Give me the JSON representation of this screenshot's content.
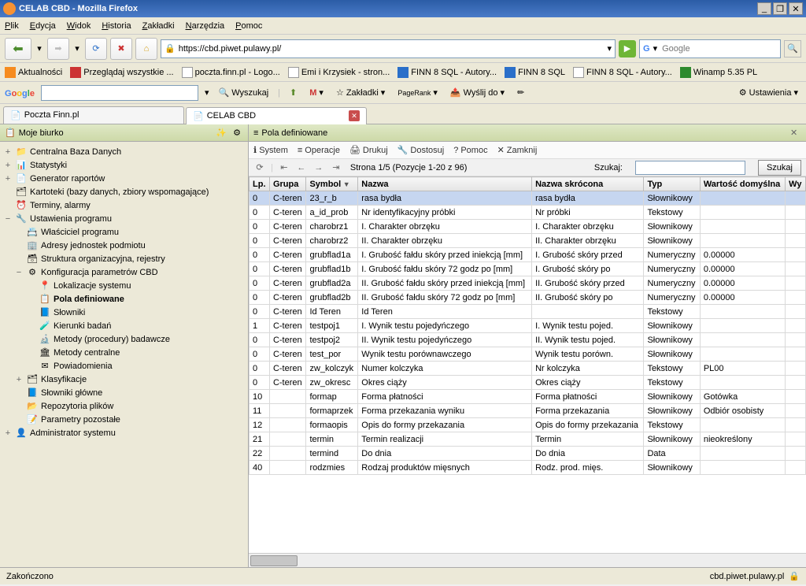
{
  "window": {
    "title": "CELAB CBD - Mozilla Firefox"
  },
  "menu": [
    "Plik",
    "Edycja",
    "Widok",
    "Historia",
    "Zakładki",
    "Narzędzia",
    "Pomoc"
  ],
  "url": "https://cbd.piwet.pulawy.pl/",
  "search_placeholder": "Google",
  "bookmarks": [
    {
      "label": "Aktualności",
      "icon": "rss"
    },
    {
      "label": "Przeglądaj wszystkie ...",
      "icon": "red"
    },
    {
      "label": "poczta.finn.pl - Logo...",
      "icon": "page"
    },
    {
      "label": "Emi i Krzysiek - stron...",
      "icon": "page"
    },
    {
      "label": "FINN 8 SQL - Autory...",
      "icon": "blue"
    },
    {
      "label": "FINN 8 SQL",
      "icon": "blue"
    },
    {
      "label": "FINN 8 SQL - Autory...",
      "icon": "page"
    },
    {
      "label": "Winamp 5.35 PL",
      "icon": "green"
    }
  ],
  "google": {
    "search_label": "Wyszukaj",
    "bookmarks_label": "Zakładki",
    "pagerank_label": "PageRank",
    "send_label": "Wyślij do",
    "settings_label": "Ustawienia"
  },
  "tabs": [
    {
      "label": "Poczta Finn.pl",
      "active": false,
      "closable": false
    },
    {
      "label": "CELAB CBD",
      "active": true,
      "closable": true
    }
  ],
  "sidebar": {
    "title": "Moje biurko",
    "tree": [
      {
        "exp": "+",
        "ind": 0,
        "icon": "📁",
        "label": "Centralna Baza Danych"
      },
      {
        "exp": "+",
        "ind": 0,
        "icon": "📊",
        "label": "Statystyki"
      },
      {
        "exp": "+",
        "ind": 0,
        "icon": "📄",
        "label": "Generator raportów"
      },
      {
        "exp": "",
        "ind": 0,
        "icon": "🗂",
        "label": "Kartoteki (bazy danych, zbiory wspomagające)"
      },
      {
        "exp": "",
        "ind": 0,
        "icon": "⏰",
        "label": "Terminy, alarmy"
      },
      {
        "exp": "−",
        "ind": 0,
        "icon": "🔧",
        "label": "Ustawienia programu"
      },
      {
        "exp": "",
        "ind": 1,
        "icon": "📇",
        "label": "Właściciel programu"
      },
      {
        "exp": "",
        "ind": 1,
        "icon": "🏢",
        "label": "Adresy jednostek podmiotu"
      },
      {
        "exp": "",
        "ind": 1,
        "icon": "🗃",
        "label": "Struktura organizacyjna, rejestry"
      },
      {
        "exp": "−",
        "ind": 1,
        "icon": "⚙",
        "label": "Konfiguracja parametrów CBD"
      },
      {
        "exp": "",
        "ind": 2,
        "icon": "📍",
        "label": "Lokalizacje systemu"
      },
      {
        "exp": "",
        "ind": 2,
        "icon": "📋",
        "label": "Pola definiowane",
        "bold": true
      },
      {
        "exp": "",
        "ind": 2,
        "icon": "📘",
        "label": "Słowniki"
      },
      {
        "exp": "",
        "ind": 2,
        "icon": "🧪",
        "label": "Kierunki badań"
      },
      {
        "exp": "",
        "ind": 2,
        "icon": "🔬",
        "label": "Metody (procedury) badawcze"
      },
      {
        "exp": "",
        "ind": 2,
        "icon": "🏛",
        "label": "Metody centralne"
      },
      {
        "exp": "",
        "ind": 2,
        "icon": "✉",
        "label": "Powiadomienia"
      },
      {
        "exp": "+",
        "ind": 1,
        "icon": "🗂",
        "label": "Klasyfikacje"
      },
      {
        "exp": "",
        "ind": 1,
        "icon": "📘",
        "label": "Słowniki główne"
      },
      {
        "exp": "",
        "ind": 1,
        "icon": "📂",
        "label": "Repozytoria plików"
      },
      {
        "exp": "",
        "ind": 1,
        "icon": "📝",
        "label": "Parametry pozostałe"
      },
      {
        "exp": "+",
        "ind": 0,
        "icon": "👤",
        "label": "Administrator systemu"
      }
    ]
  },
  "content": {
    "title": "Pola definiowane",
    "toolbar": [
      {
        "icon": "ℹ",
        "label": "System"
      },
      {
        "icon": "≡",
        "label": "Operacje"
      },
      {
        "icon": "🖨",
        "label": "Drukuj"
      },
      {
        "icon": "🔧",
        "label": "Dostosuj"
      },
      {
        "icon": "?",
        "label": "Pomoc"
      },
      {
        "icon": "✕",
        "label": "Zamknij"
      }
    ],
    "pager": {
      "info": "Strona 1/5 (Pozycje 1-20 z 96)",
      "search_label": "Szukaj:",
      "search_button": "Szukaj"
    },
    "columns": [
      "Lp.",
      "Grupa",
      "Symbol",
      "Nazwa",
      "Nazwa skrócona",
      "Typ",
      "Wartość domyślna",
      "Wy"
    ],
    "sorted_col": 2,
    "rows": [
      {
        "sel": true,
        "c": [
          "0",
          "C-teren",
          "23_r_b",
          "rasa bydła",
          "rasa bydła",
          "Słownikowy",
          "",
          ""
        ]
      },
      {
        "sel": false,
        "c": [
          "0",
          "C-teren",
          "a_id_prob",
          "Nr identyfikacyjny próbki",
          "Nr próbki",
          "Tekstowy",
          "",
          ""
        ]
      },
      {
        "sel": false,
        "c": [
          "0",
          "C-teren",
          "charobrz1",
          "I. Charakter obrzęku",
          "I. Charakter obrzęku",
          "Słownikowy",
          "",
          ""
        ]
      },
      {
        "sel": false,
        "c": [
          "0",
          "C-teren",
          "charobrz2",
          "II. Charakter obrzęku",
          "II. Charakter obrzęku",
          "Słownikowy",
          "",
          ""
        ]
      },
      {
        "sel": false,
        "c": [
          "0",
          "C-teren",
          "grubflad1a",
          "I. Grubość fałdu skóry przed iniekcją [mm]",
          "I. Grubość skóry przed",
          "Numeryczny",
          "0.00000",
          ""
        ]
      },
      {
        "sel": false,
        "c": [
          "0",
          "C-teren",
          "grubflad1b",
          "I. Grubość fałdu skóry 72 godz po [mm]",
          "I. Grubość skóry po",
          "Numeryczny",
          "0.00000",
          ""
        ]
      },
      {
        "sel": false,
        "c": [
          "0",
          "C-teren",
          "grubflad2a",
          "II. Grubość fałdu skóry przed iniekcją [mm]",
          "II. Grubość skóry przed",
          "Numeryczny",
          "0.00000",
          ""
        ]
      },
      {
        "sel": false,
        "c": [
          "0",
          "C-teren",
          "grubflad2b",
          "II. Grubość fałdu skóry 72 godz po [mm]",
          "II. Grubość skóry po",
          "Numeryczny",
          "0.00000",
          ""
        ]
      },
      {
        "sel": false,
        "c": [
          "0",
          "C-teren",
          "Id Teren",
          "Id Teren",
          "",
          "Tekstowy",
          "",
          ""
        ]
      },
      {
        "sel": false,
        "c": [
          "1",
          "C-teren",
          "testpoj1",
          "I. Wynik testu pojedyńczego",
          "I. Wynik testu pojed.",
          "Słownikowy",
          "",
          ""
        ]
      },
      {
        "sel": false,
        "c": [
          "0",
          "C-teren",
          "testpoj2",
          "II. Wynik testu pojedyńczego",
          "II. Wynik testu pojed.",
          "Słownikowy",
          "",
          ""
        ]
      },
      {
        "sel": false,
        "c": [
          "0",
          "C-teren",
          "test_por",
          "Wynik testu porównawczego",
          "Wynik testu porówn.",
          "Słownikowy",
          "",
          ""
        ]
      },
      {
        "sel": false,
        "c": [
          "0",
          "C-teren",
          "zw_kolczyk",
          "Numer kolczyka",
          "Nr kolczyka",
          "Tekstowy",
          "PL00",
          ""
        ]
      },
      {
        "sel": false,
        "c": [
          "0",
          "C-teren",
          "zw_okresc",
          "Okres ciąży",
          "Okres ciąży",
          "Tekstowy",
          "",
          ""
        ]
      },
      {
        "sel": false,
        "c": [
          "10",
          "",
          "formap",
          "Forma płatności",
          "Forma płatności",
          "Słownikowy",
          "Gotówka",
          ""
        ]
      },
      {
        "sel": false,
        "c": [
          "11",
          "",
          "formaprzek",
          "Forma przekazania wyniku",
          "Forma przekazania",
          "Słownikowy",
          "Odbiór osobisty",
          ""
        ]
      },
      {
        "sel": false,
        "c": [
          "12",
          "",
          "formaopis",
          "Opis do formy przekazania",
          "Opis do formy przekazania",
          "Tekstowy",
          "",
          ""
        ]
      },
      {
        "sel": false,
        "c": [
          "21",
          "",
          "termin",
          "Termin realizacji",
          "Termin",
          "Słownikowy",
          "nieokreślony",
          ""
        ]
      },
      {
        "sel": false,
        "c": [
          "22",
          "",
          "termind",
          "Do dnia",
          "Do dnia",
          "Data",
          "",
          ""
        ]
      },
      {
        "sel": false,
        "c": [
          "40",
          "",
          "rodzmies",
          "Rodzaj produktów mięsnych",
          "Rodz. prod. mięs.",
          "Słownikowy",
          "",
          ""
        ]
      }
    ]
  },
  "status": {
    "left": "Zakończono",
    "right": "cbd.piwet.pulawy.pl"
  }
}
